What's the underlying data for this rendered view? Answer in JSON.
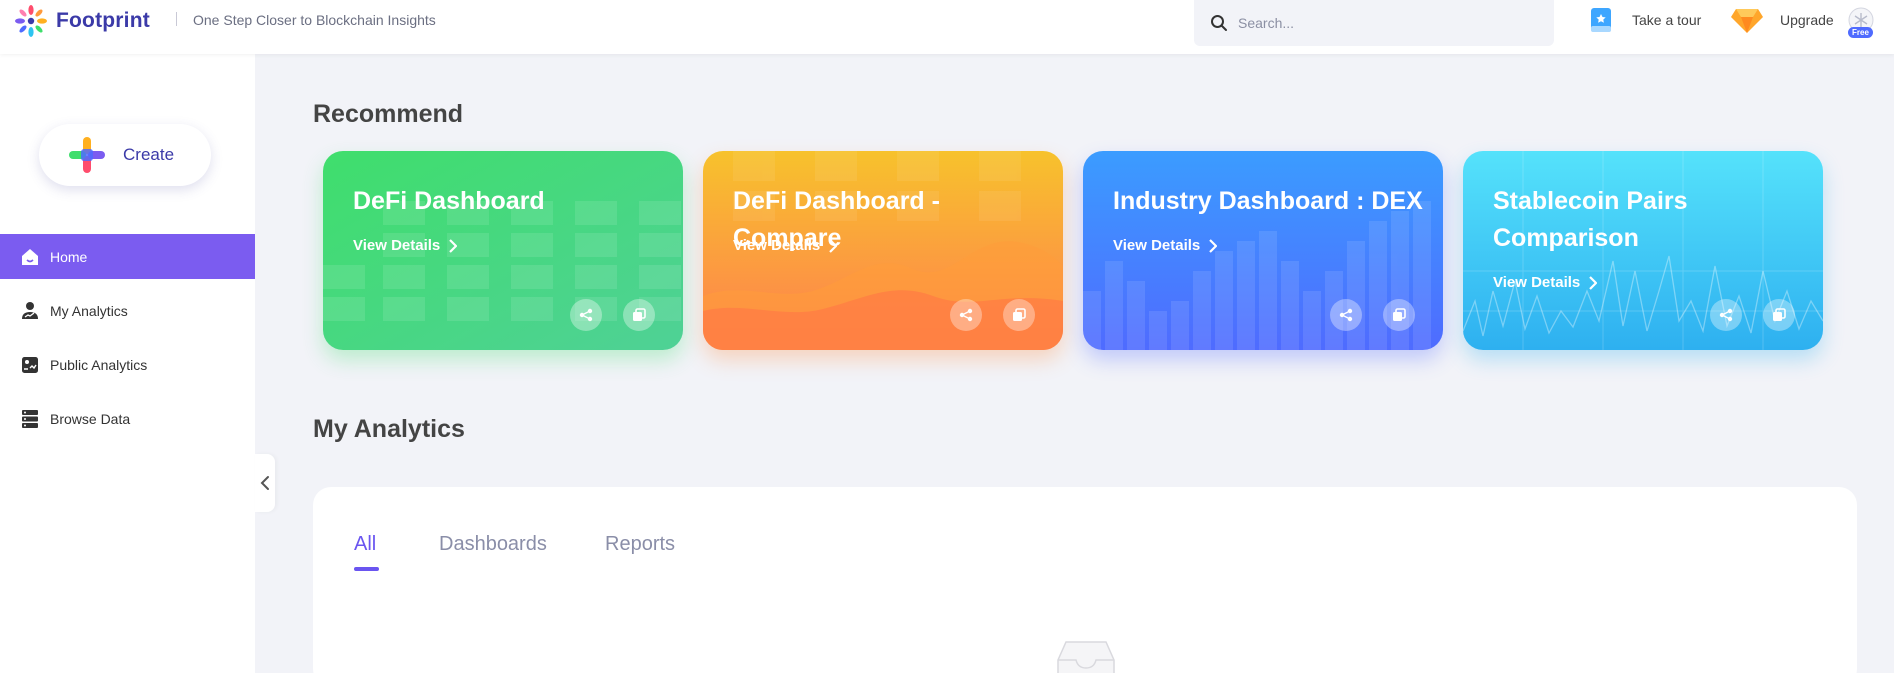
{
  "header": {
    "brand": "Footprint",
    "tagline": "One Step Closer to Blockchain Insights",
    "search_placeholder": "Search...",
    "take_tour": "Take a tour",
    "upgrade": "Upgrade",
    "plan_badge": "Free"
  },
  "sidebar": {
    "create_label": "Create",
    "items": [
      {
        "label": "Home",
        "icon": "home-icon",
        "active": true
      },
      {
        "label": "My Analytics",
        "icon": "user-chart-icon",
        "active": false
      },
      {
        "label": "Public Analytics",
        "icon": "public-analytics-icon",
        "active": false
      },
      {
        "label": "Browse Data",
        "icon": "database-icon",
        "active": false
      }
    ]
  },
  "recommend": {
    "title": "Recommend",
    "cards": [
      {
        "title": "DeFi Dashboard",
        "link": "View Details",
        "color_from": "#3fde6c",
        "color_to": "#4fd196"
      },
      {
        "title": "DeFi Dashboard - Compare",
        "link": "View Details",
        "color_from": "#f7c22c",
        "color_to": "#ff7f4f"
      },
      {
        "title": "Industry Dashboard : DEX",
        "link": "View Details",
        "color_from": "#3b9cff",
        "color_to": "#4f6bff"
      },
      {
        "title": "Stablecoin Pairs Comparison",
        "link": "View Details",
        "color_from": "#55e2fb",
        "color_to": "#2eb0f0"
      }
    ]
  },
  "my_analytics": {
    "title": "My Analytics",
    "tabs": [
      {
        "label": "All",
        "active": true
      },
      {
        "label": "Dashboards",
        "active": false
      },
      {
        "label": "Reports",
        "active": false
      }
    ]
  },
  "colors": {
    "brand": "#3b3aa8",
    "active_nav": "#7b5cf0",
    "tab_active": "#6a55f0",
    "background": "#f2f3f8"
  }
}
